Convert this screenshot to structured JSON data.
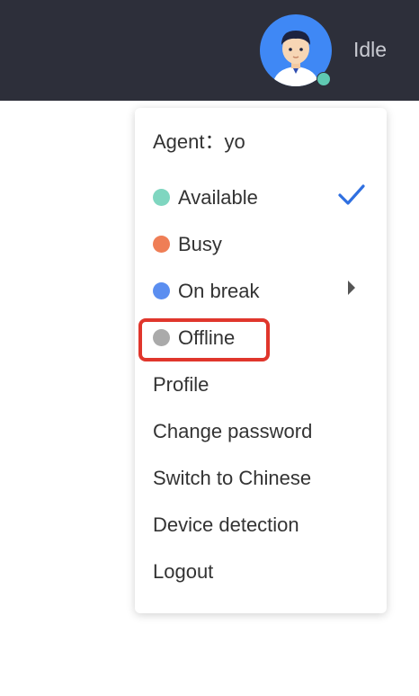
{
  "header": {
    "status_text": "Idle",
    "avatar_status_color": "#5fc9b2",
    "background_color": "#2d2f3a"
  },
  "menu": {
    "agent_label": "Agent：yo",
    "status_items": [
      {
        "label": "Available",
        "color": "#7fd6c0",
        "selected": true
      },
      {
        "label": "Busy",
        "color": "#ef7e56"
      },
      {
        "label": "On break",
        "color": "#5b8ef0",
        "has_submenu": true
      },
      {
        "label": "Offline",
        "color": "#aaaaaa",
        "highlighted": true
      }
    ],
    "actions": [
      {
        "label": "Profile"
      },
      {
        "label": "Change password"
      },
      {
        "label": "Switch to Chinese"
      },
      {
        "label": "Device detection"
      },
      {
        "label": "Logout"
      }
    ],
    "check_icon": "checkmark-icon",
    "submenu_icon": "caret-right-icon",
    "check_color": "#2f6fe0",
    "highlight_color": "#e0362c"
  }
}
